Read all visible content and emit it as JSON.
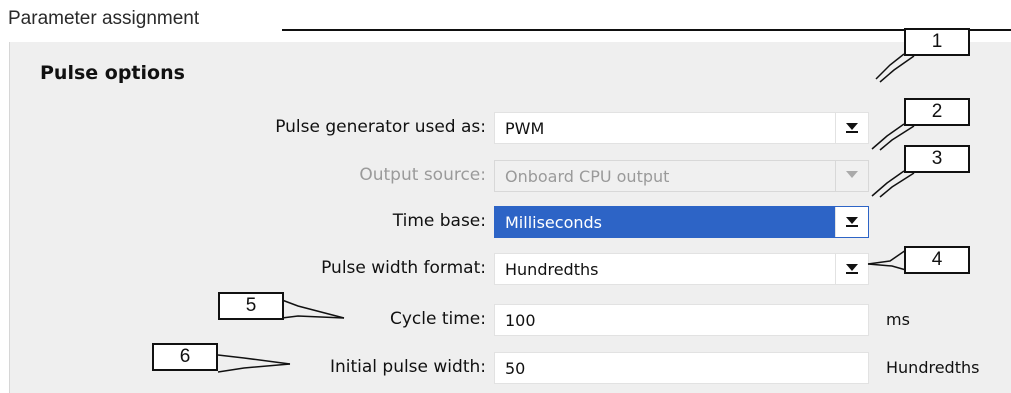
{
  "group_title": "Parameter assignment",
  "section_title": "Pulse options",
  "fields": [
    {
      "label": "Pulse generator used as:",
      "value": "PWM",
      "type": "dropdown",
      "enabled": true
    },
    {
      "label": "Output source:",
      "value": "Onboard CPU output",
      "type": "dropdown",
      "enabled": false
    },
    {
      "label": "Time base:",
      "value": "Milliseconds",
      "type": "dropdown",
      "enabled": true,
      "selected": true
    },
    {
      "label": "Pulse width format:",
      "value": "Hundredths",
      "type": "dropdown",
      "enabled": true
    },
    {
      "label": "Cycle time:",
      "value": "100",
      "type": "text",
      "unit": "ms"
    },
    {
      "label": "Initial pulse width:",
      "value": "50",
      "type": "text",
      "unit": "Hundredths"
    }
  ],
  "callouts": [
    "1",
    "2",
    "3",
    "4",
    "5",
    "6"
  ],
  "colors": {
    "selection": "#2d64c6",
    "panel": "#efefef",
    "disabled_text": "#9a9a9a"
  },
  "icons": {
    "dropdown": "triangle-down-icon"
  }
}
